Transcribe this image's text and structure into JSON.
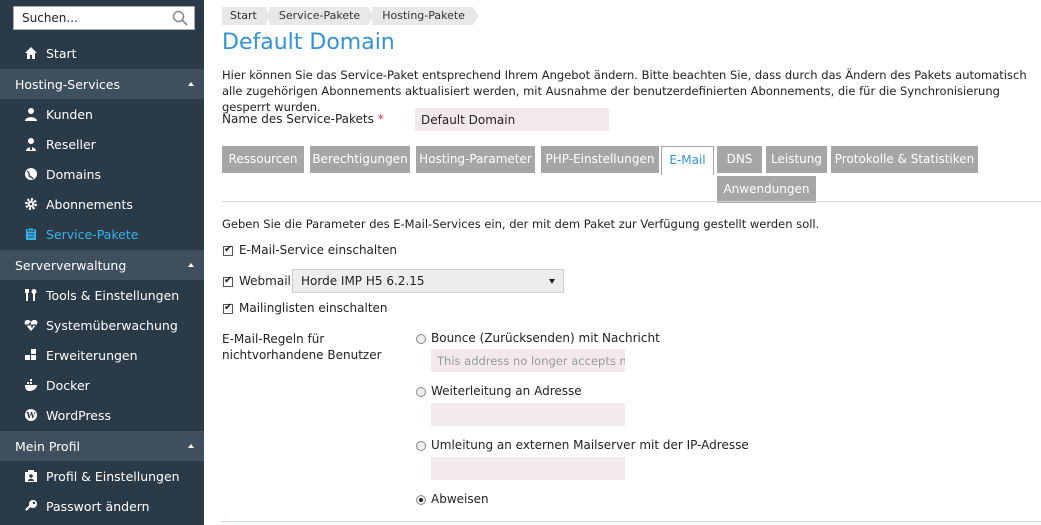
{
  "sidebar": {
    "search_placeholder": "Suchen...",
    "start": "Start",
    "sections": [
      {
        "label": "Hosting-Services"
      },
      {
        "label": "Serververwaltung"
      },
      {
        "label": "Mein Profil"
      }
    ],
    "hosting_items": [
      "Kunden",
      "Reseller",
      "Domains",
      "Abonnements",
      "Service-Pakete"
    ],
    "server_items": [
      "Tools & Einstellungen",
      "Systemüberwachung",
      "Erweiterungen",
      "Docker",
      "WordPress"
    ],
    "profile_items": [
      "Profil & Einstellungen",
      "Passwort ändern"
    ],
    "active_color": "#35b3ea",
    "bg_color": "#2b3a47"
  },
  "breadcrumb": [
    "Start",
    "Service-Pakete",
    "Hosting-Pakete"
  ],
  "page": {
    "title": "Default Domain",
    "intro": "Hier können Sie das Service-Paket entsprechend Ihrem Angebot ändern. Bitte beachten Sie, dass durch das Ändern des Pakets automatisch alle zugehörigen Abonnements aktualisiert werden, mit Ausnahme der benutzerdefinierten Abonnements, die für die Synchronisierung gesperrt wurden.",
    "name_label": "Name des Service-Pakets",
    "required_mark": "*",
    "name_value": "Default Domain"
  },
  "tabs": [
    "Ressourcen",
    "Berechtigungen",
    "Hosting-Parameter",
    "PHP-Einstellungen",
    "E-Mail",
    "DNS",
    "Leistung",
    "Protokolle & Statistiken",
    "Anwendungen"
  ],
  "active_tab": "E-Mail",
  "email": {
    "description": "Geben Sie die Parameter des E-Mail-Services ein, der mit dem Paket zur Verfügung gestellt werden soll.",
    "enable_service_label": "E-Mail-Service einschalten",
    "webmail_label": "Webmail",
    "webmail_value": "Horde IMP H5 6.2.15",
    "mailing_lists_label": "Mailinglisten einschalten",
    "rules_label": "E-Mail-Regeln für nichtvorhandene Benutzer",
    "options": [
      {
        "label": "Bounce (Zurücksenden) mit Nachricht",
        "placeholder": "This address no longer accepts m"
      },
      {
        "label": "Weiterleitung an Adresse",
        "placeholder": ""
      },
      {
        "label": "Umleitung an externen Mailserver mit der IP-Adresse",
        "placeholder": ""
      },
      {
        "label": "Abweisen"
      }
    ],
    "selected_option": "Abweisen"
  }
}
